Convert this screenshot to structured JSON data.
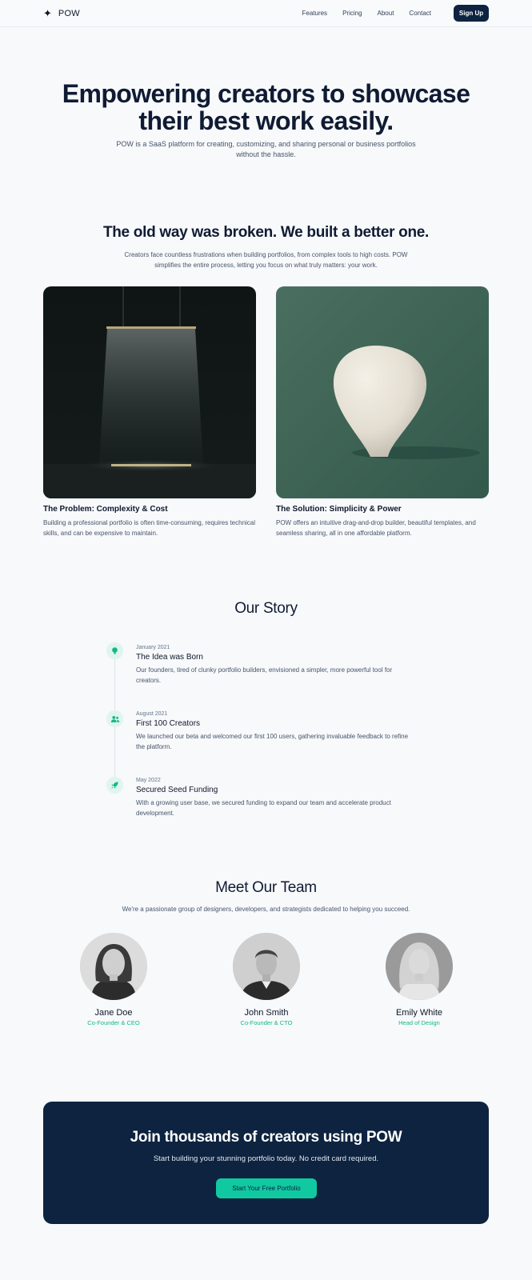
{
  "nav": {
    "logo_icon": "✦",
    "logo_text": "POW",
    "links": [
      "Features",
      "Pricing",
      "About",
      "Contact"
    ],
    "signup_label": "Sign Up"
  },
  "hero": {
    "title_line1": "Empowering creators to showcase",
    "title_line2": "their best work easily.",
    "subtitle": "POW is a SaaS platform for creating, customizing, and sharing personal or business portfolios without the hassle."
  },
  "compare": {
    "title": "The old way was broken. We built a better one.",
    "subtitle": "Creators face countless frustrations when building portfolios, from complex tools to high costs. POW simplifies the entire process, letting you focus on what truly matters: your work.",
    "cards": [
      {
        "title": "The Problem: Complexity & Cost",
        "text": "Building a professional portfolio is often time-consuming, requires technical skills, and can be expensive to maintain."
      },
      {
        "title": "The Solution: Simplicity & Power",
        "text": "POW offers an intuitive drag-and-drop builder, beautiful templates, and seamless sharing, all in one affordable platform."
      }
    ]
  },
  "story": {
    "title": "Our Story",
    "items": [
      {
        "date": "January 2021",
        "title": "The Idea was Born",
        "text": "Our founders, tired of clunky portfolio builders, envisioned a simpler, more powerful tool for creators.",
        "icon": "lightbulb-icon"
      },
      {
        "date": "August 2021",
        "title": "First 100 Creators",
        "text": "We launched our beta and welcomed our first 100 users, gathering invaluable feedback to refine the platform.",
        "icon": "users-icon"
      },
      {
        "date": "May 2022",
        "title": "Secured Seed Funding",
        "text": "With a growing user base, we secured funding to expand our team and accelerate product development.",
        "icon": "rocket-icon"
      }
    ]
  },
  "team": {
    "title": "Meet Our Team",
    "subtitle": "We're a passionate group of designers, developers, and strategists dedicated to helping you succeed.",
    "members": [
      {
        "name": "Jane Doe",
        "role": "Co-Founder & CEO"
      },
      {
        "name": "John Smith",
        "role": "Co-Founder & CTO"
      },
      {
        "name": "Emily White",
        "role": "Head of Design"
      }
    ]
  },
  "cta": {
    "title": "Join thousands of creators using POW",
    "subtitle": "Start building your stunning portfolio today. No credit card required.",
    "button_label": "Start Your Free Portfolio"
  },
  "colors": {
    "accent": "#10b981",
    "navy": "#0d2340",
    "background": "#f7f9fb"
  }
}
